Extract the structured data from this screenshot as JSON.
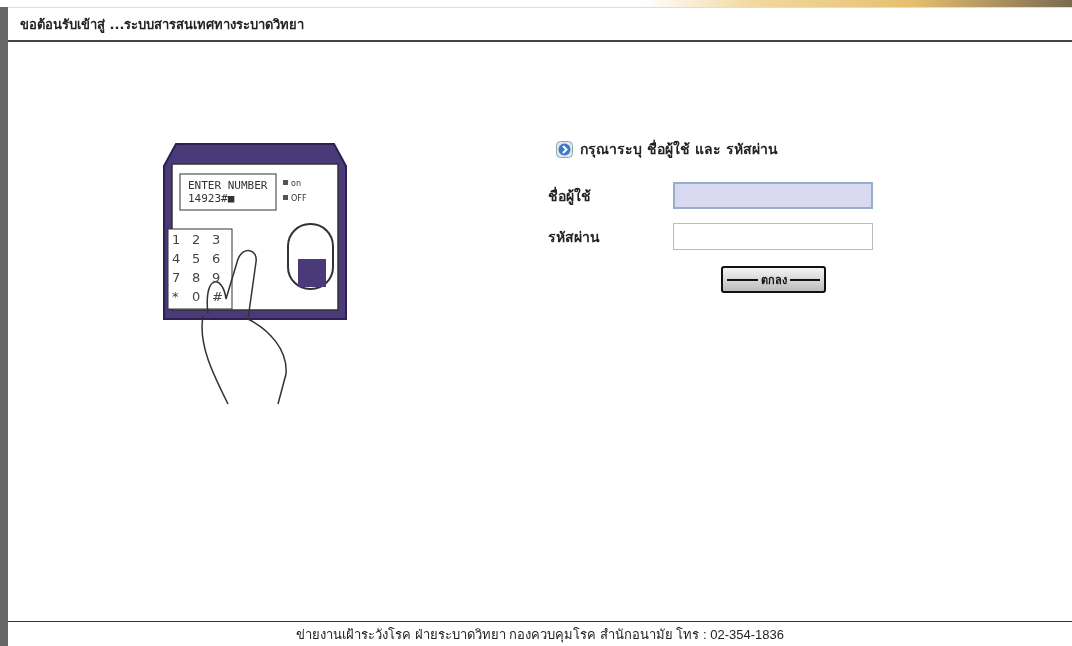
{
  "header": {
    "title": "ขอต้อนรับเข้าสู่ ...ระบบสารสนเทศทางระบาดวิทยา"
  },
  "illustration": {
    "display_lines": [
      "ENTER NUMBER",
      "14923#■"
    ],
    "indicators": [
      "on",
      "OFF"
    ],
    "keys": [
      "1",
      "2",
      "3",
      "4",
      "5",
      "6",
      "7",
      "8",
      "9",
      "*",
      "0",
      "#"
    ]
  },
  "login": {
    "prompt": "กรุณาระบุ ชื่อผู้ใช้ และ รหัสผ่าน",
    "fields": [
      {
        "label": "ชื่อผู้ใช้",
        "focused": true
      },
      {
        "label": "รหัสผ่าน",
        "focused": false
      }
    ],
    "submit": "ตกลง"
  },
  "footer": {
    "text": "ข่ายงานเฝ้าระวังโรค ฝ่ายระบาดวิทยา กองควบคุมโรค สำนักอนามัย โทร : 02-354-1836"
  }
}
